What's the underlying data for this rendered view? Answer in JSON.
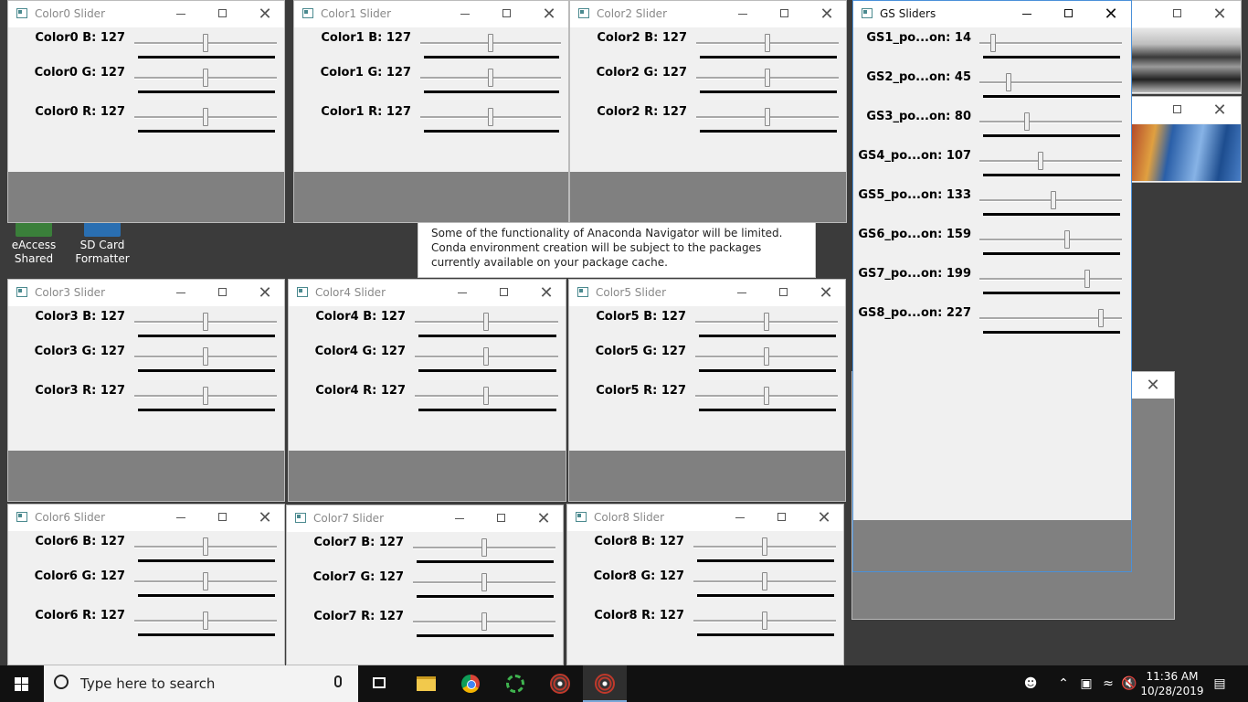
{
  "desktop_icons": [
    {
      "label": "eAccess Shared"
    },
    {
      "label": "SD Card Formatter"
    }
  ],
  "notice_text": "Some of the functionality of Anaconda Navigator will be limited. Conda environment creation will be subject to the packages currently available on your package cache.",
  "color_windows": [
    {
      "title": "Color0 Slider",
      "b": "Color0 B: 127",
      "g": "Color0 G: 127",
      "r": "Color0 R: 127"
    },
    {
      "title": "Color1 Slider",
      "b": "Color1 B: 127",
      "g": "Color1 G: 127",
      "r": "Color1 R: 127"
    },
    {
      "title": "Color2 Slider",
      "b": "Color2 B: 127",
      "g": "Color2 G: 127",
      "r": "Color2 R: 127"
    },
    {
      "title": "Color3 Slider",
      "b": "Color3 B: 127",
      "g": "Color3 G: 127",
      "r": "Color3 R: 127"
    },
    {
      "title": "Color4 Slider",
      "b": "Color4 B: 127",
      "g": "Color4 G: 127",
      "r": "Color4 R: 127"
    },
    {
      "title": "Color5 Slider",
      "b": "Color5 B: 127",
      "g": "Color5 G: 127",
      "r": "Color5 R: 127"
    },
    {
      "title": "Color6 Slider",
      "b": "Color6 B: 127",
      "g": "Color6 G: 127",
      "r": "Color6 R: 127"
    },
    {
      "title": "Color7 Slider",
      "b": "Color7 B: 127",
      "g": "Color7 G: 127",
      "r": "Color7 R: 127"
    },
    {
      "title": "Color8 Slider",
      "b": "Color8 B: 127",
      "g": "Color8 G: 127",
      "r": "Color8 R: 127"
    }
  ],
  "gs_window": {
    "title": "GS Sliders",
    "sliders": [
      {
        "label": "GS1_po...on: 14",
        "value": 14
      },
      {
        "label": "GS2_po...on: 45",
        "value": 45
      },
      {
        "label": "GS3_po...on: 80",
        "value": 80
      },
      {
        "label": "GS4_po...on: 107",
        "value": 107
      },
      {
        "label": "GS5_po...on: 133",
        "value": 133
      },
      {
        "label": "GS6_po...on: 159",
        "value": 159
      },
      {
        "label": "GS7_po...on: 199",
        "value": 199
      },
      {
        "label": "GS8_po...on: 227",
        "value": 227
      }
    ]
  },
  "slider_max": 255,
  "color_slider_value": 127,
  "taskbar": {
    "search_placeholder": "Type here to search",
    "time": "11:36 AM",
    "date": "10/28/2019"
  },
  "colors": {
    "accent": "#4a90d9",
    "gray_canvas": "#808080",
    "taskbar": "#111111"
  }
}
